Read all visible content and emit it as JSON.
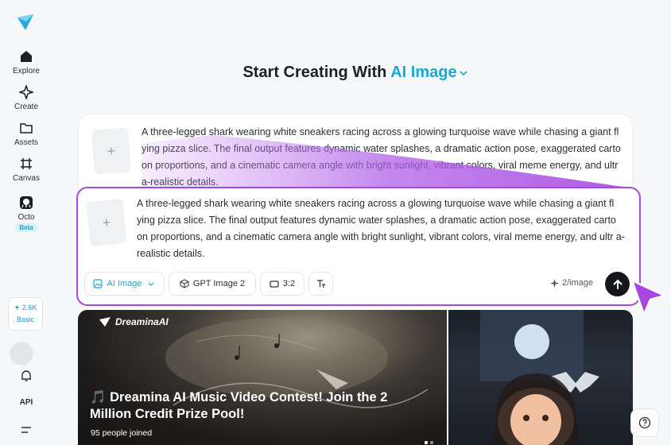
{
  "sidebar": {
    "items": [
      {
        "label": "Explore",
        "icon": "home-icon"
      },
      {
        "label": "Create",
        "icon": "sparkle-icon"
      },
      {
        "label": "Assets",
        "icon": "folder-icon"
      },
      {
        "label": "Canvas",
        "icon": "canvas-icon"
      },
      {
        "label": "Octo",
        "icon": "octo-icon",
        "badge": "Beta"
      }
    ],
    "credits": {
      "amount": "✦ 2.6K",
      "plan": "Basic"
    },
    "api_label": "API"
  },
  "heading": {
    "prefix": "Start Creating With",
    "accent": "AI Image"
  },
  "prompt": {
    "ghost_text": "A three-legged shark wearing white sneakers racing across a glowing turquoise wave while chasing a giant fl ying pizza slice. The final output features dynamic water splashes, a dramatic action pose, exaggerated carto on proportions, and a cinematic camera angle with bright sunlight, vibrant colors, viral meme energy, and ultr a-realistic details.",
    "text": "A three-legged shark wearing white sneakers racing across a glowing turquoise wave while chasing a giant fl ying pizza slice. The final output features dynamic water splashes, a dramatic action pose, exaggerated carto on proportions, and a cinematic camera angle with bright sunlight, vibrant colors, viral meme energy, and ultr a-realistic details.",
    "thumb_symbol": "+"
  },
  "toolbar": {
    "mode": "AI Image",
    "model": "GPT Image 2",
    "ratio": "3:2",
    "cost": "2/image"
  },
  "banner": {
    "brand": "DreaminaAI",
    "title": "🎵 Dreamina AI Music Video Contest! Join the 2 Million Credit Prize Pool!",
    "joined": "95 people joined"
  },
  "colors": {
    "accent": "#18a9d6",
    "highlight": "#a748e0",
    "send": "#15171a"
  }
}
